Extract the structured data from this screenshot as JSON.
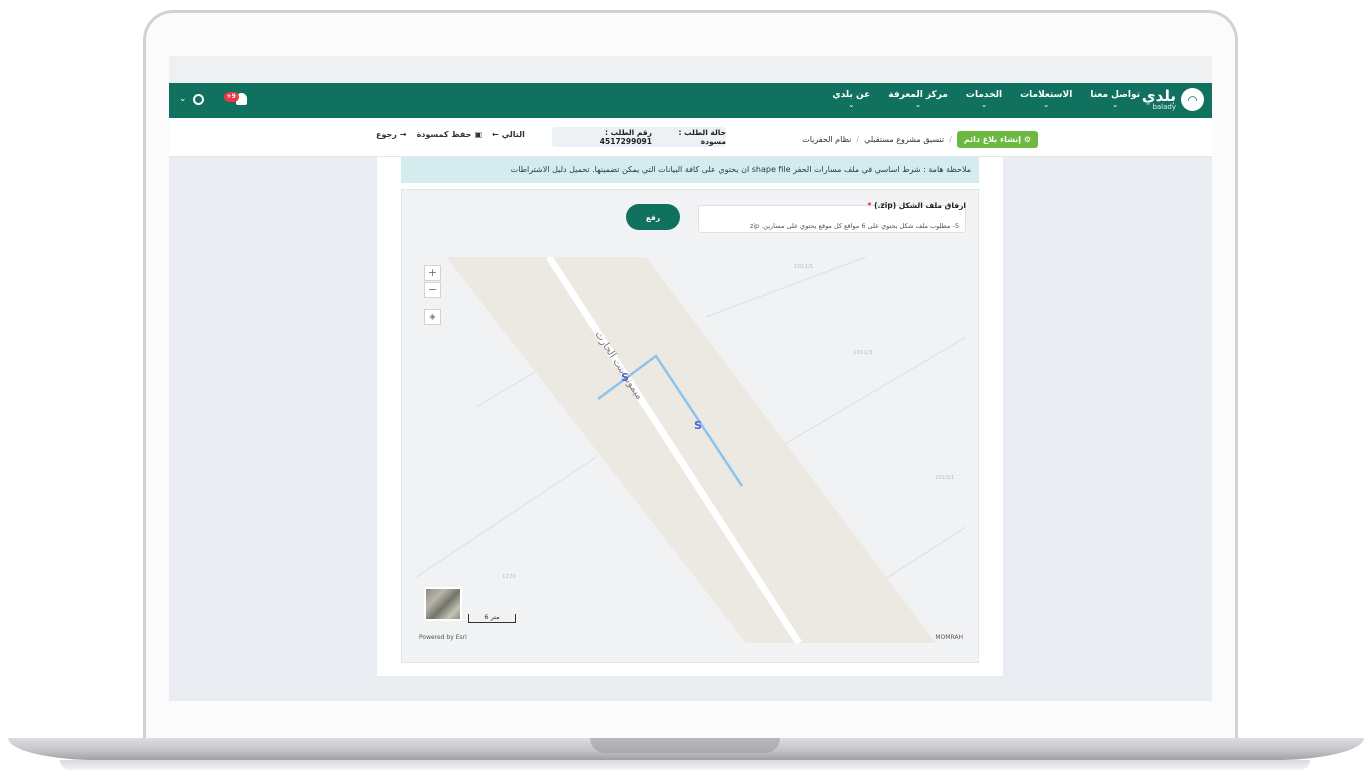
{
  "navbar": {
    "logo_ar": "بلدي",
    "logo_en": "balady",
    "menu": [
      "عن بلدي",
      "مركز المعرفة",
      "الخدمات",
      "الاستعلامات",
      "تواصل معنا"
    ],
    "notifications_badge": "+9"
  },
  "breadcrumb": {
    "root": "نظام الحفريات",
    "current": "تنسيق مشروع مستقبلي",
    "report_button": "إنشاء بلاغ دائم"
  },
  "request": {
    "number_label": "رقم الطلب : 4517299091",
    "status_label": "حالة الطلب : مسودة"
  },
  "actions": {
    "back": "رجوع",
    "save_draft": "حفظ كمسودة",
    "next": "التالي"
  },
  "note": {
    "text": "ملاحظة هامة : شرط اساسي في ملف مسارات الحفر shape file ان يحتوي على كافة البيانات التي يمكن تضمينها. تحميل دليل الاشتراطات"
  },
  "upload": {
    "label": "ارفاق ملف الشكل (zip.)",
    "hint": "5- مطلوب ملف شكل يحتوي على 6 مواقع كل موقع يحتوي على مسارين. zip",
    "button": "رفع"
  },
  "map": {
    "street_name": "ميمونة بنت الحارث",
    "parcels": [
      "1011/1",
      "1011/3",
      "1013/1",
      "1270"
    ],
    "scale_label": "6 متر",
    "powered_by": "Powered by Esri",
    "attribution": "MOMRAH",
    "zoom_in": "+",
    "zoom_out": "−"
  }
}
